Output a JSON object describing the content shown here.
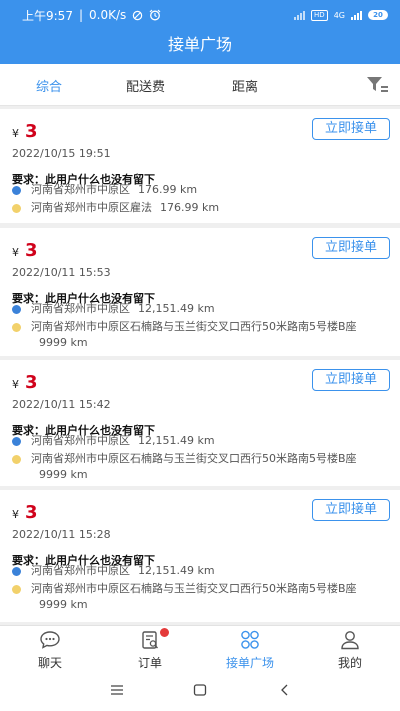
{
  "status_bar": {
    "time": "上午9:57",
    "speed": "0.0K/s",
    "network_tag": "HD",
    "network_type": "4G",
    "battery": "20",
    "icons": [
      "data-saver-icon",
      "alarm-icon",
      "wifi-signal-icon",
      "cell-signal-icon",
      "battery-icon"
    ]
  },
  "app_bar": {
    "title": "接单广场"
  },
  "filter": {
    "tabs": [
      "综合",
      "配送费",
      "距离"
    ],
    "active_color": "#3b92ec",
    "icon": "filter-icon"
  },
  "orders": [
    {
      "currency": "¥",
      "price": "3",
      "button": "立即接单",
      "date": "2022/10/15 19:51",
      "requirement": "要求：此用户什么也没有留下",
      "from": "河南省郑州市中原区",
      "from_dist": "176.99 km",
      "to": "河南省郑州市中原区雇法",
      "to_dist": "176.99 km"
    },
    {
      "currency": "¥",
      "price": "3",
      "button": "立即接单",
      "date": "2022/10/11 15:53",
      "requirement": "要求：此用户什么也没有留下",
      "from": "河南省郑州市中原区",
      "from_dist": "12,151.49 km",
      "to": "河南省郑州市中原区石楠路与玉兰街交叉口西行50米路南5号楼B座",
      "to_dist": "9999 km"
    },
    {
      "currency": "¥",
      "price": "3",
      "button": "立即接单",
      "date": "2022/10/11 15:42",
      "requirement": "要求：此用户什么也没有留下",
      "from": "河南省郑州市中原区",
      "from_dist": "12,151.49 km",
      "to": "河南省郑州市中原区石楠路与玉兰街交叉口西行50米路南5号楼B座",
      "to_dist": "9999 km"
    },
    {
      "currency": "¥",
      "price": "3",
      "button": "立即接单",
      "date": "2022/10/11 15:28",
      "requirement": "要求：此用户什么也没有留下",
      "from": "河南省郑州市中原区",
      "from_dist": "12,151.49 km",
      "to": "河南省郑州市中原区石楠路与玉兰街交叉口西行50米路南5号楼B座",
      "to_dist": "9999 km"
    }
  ],
  "tab_bar": {
    "items": [
      {
        "label": "聊天",
        "icon": "chat-icon"
      },
      {
        "label": "订单",
        "icon": "order-icon"
      },
      {
        "label": "接单广场",
        "icon": "grid-icon"
      },
      {
        "label": "我的",
        "icon": "user-icon"
      }
    ],
    "active_index": 2
  },
  "nav_bar": {
    "icons": [
      "menu-icon",
      "home-icon",
      "back-icon"
    ]
  },
  "colors": {
    "primary": "#3b92ec",
    "price": "#d0021b",
    "badge": "#e43a3a",
    "dot_from": "#3b82d9",
    "dot_to": "#f2d16b"
  }
}
